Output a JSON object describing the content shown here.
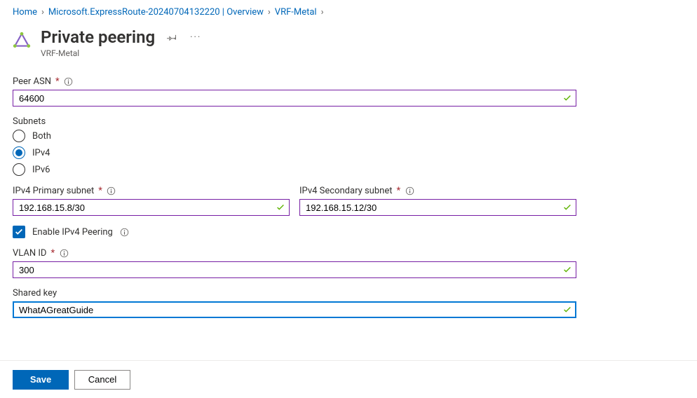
{
  "breadcrumb": {
    "items": [
      {
        "label": "Home"
      },
      {
        "label": "Microsoft.ExpressRoute-20240704132220 | Overview"
      },
      {
        "label": "VRF-Metal"
      }
    ]
  },
  "header": {
    "title": "Private peering",
    "subtitle": "VRF-Metal"
  },
  "form": {
    "peer_asn": {
      "label": "Peer ASN",
      "value": "64600",
      "valid": true
    },
    "subnets": {
      "label": "Subnets",
      "options": {
        "both": "Both",
        "ipv4": "IPv4",
        "ipv6": "IPv6"
      },
      "selected": "ipv4"
    },
    "ipv4_primary": {
      "label": "IPv4 Primary subnet",
      "value": "192.168.15.8/30",
      "valid": true
    },
    "ipv4_secondary": {
      "label": "IPv4 Secondary subnet",
      "value": "192.168.15.12/30",
      "valid": true
    },
    "enable_ipv4": {
      "label": "Enable IPv4 Peering",
      "checked": true
    },
    "vlan_id": {
      "label": "VLAN ID",
      "value": "300",
      "valid": true
    },
    "shared_key": {
      "label": "Shared key",
      "value": "WhatAGreatGuide",
      "valid": true
    }
  },
  "footer": {
    "save": "Save",
    "cancel": "Cancel"
  }
}
